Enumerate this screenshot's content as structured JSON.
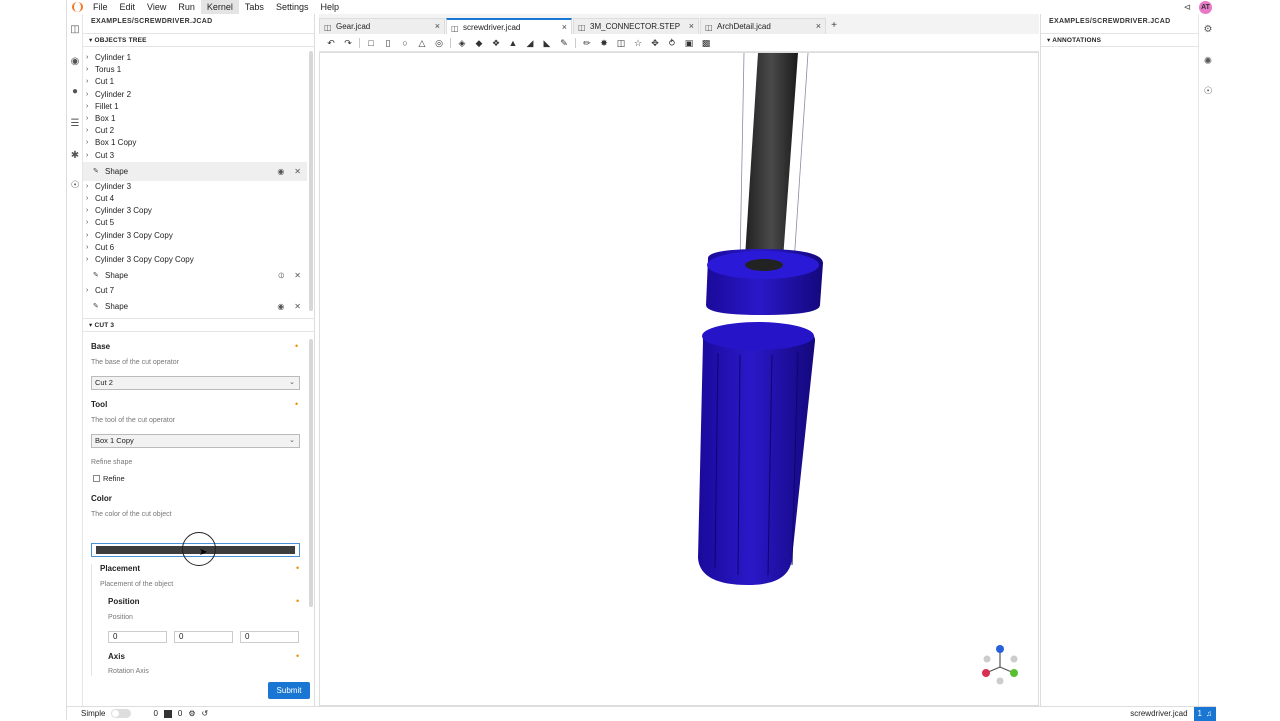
{
  "menu": [
    "File",
    "Edit",
    "View",
    "Run",
    "Kernel",
    "Tabs",
    "Settings",
    "Help"
  ],
  "menu_active": "Kernel",
  "user_initials": "AT",
  "left_panel": {
    "path": "EXAMPLES/SCREWDRIVER.JCAD",
    "objects_tree_title": "OBJECTS TREE",
    "tree": [
      {
        "label": "Cylinder 1",
        "type": "item"
      },
      {
        "label": "Torus 1",
        "type": "item"
      },
      {
        "label": "Cut 1",
        "type": "item"
      },
      {
        "label": "Cylinder 2",
        "type": "item"
      },
      {
        "label": "Fillet 1",
        "type": "item"
      },
      {
        "label": "Box 1",
        "type": "item"
      },
      {
        "label": "Cut 2",
        "type": "item"
      },
      {
        "label": "Box 1 Copy",
        "type": "item"
      },
      {
        "label": "Cut 3",
        "type": "item"
      },
      {
        "label": "Shape",
        "type": "shape",
        "visible": true,
        "highlighted": true
      },
      {
        "label": "Cylinder 3",
        "type": "item"
      },
      {
        "label": "Cut 4",
        "type": "item"
      },
      {
        "label": "Cylinder 3 Copy",
        "type": "item"
      },
      {
        "label": "Cut 5",
        "type": "item"
      },
      {
        "label": "Cylinder 3 Copy Copy",
        "type": "item"
      },
      {
        "label": "Cut 6",
        "type": "item"
      },
      {
        "label": "Cylinder 3 Copy Copy Copy",
        "type": "item"
      },
      {
        "label": "Shape",
        "type": "shape",
        "visible": false,
        "highlighted": false
      },
      {
        "label": "Cut 7",
        "type": "item"
      },
      {
        "label": "Shape",
        "type": "shape",
        "visible": true,
        "highlighted": false
      }
    ],
    "form_title": "CUT 3",
    "form": {
      "base_label": "Base",
      "base_desc": "The base of the cut operator",
      "base_value": "Cut 2",
      "tool_label": "Tool",
      "tool_desc": "The tool of the cut operator",
      "tool_value": "Box 1 Copy",
      "refine_desc": "Refine shape",
      "refine_label": "Refine",
      "color_label": "Color",
      "color_desc": "The color of the cut object",
      "color_value": "#3d3d3d",
      "placement_label": "Placement",
      "placement_desc": "Placement of the object",
      "position_label": "Position",
      "position_desc": "Position",
      "position_values": [
        "0",
        "0",
        "0"
      ],
      "axis_label": "Axis",
      "axis_desc": "Rotation Axis",
      "submit_label": "Submit"
    }
  },
  "tabs": [
    {
      "label": "Gear.jcad",
      "active": false
    },
    {
      "label": "screwdriver.jcad",
      "active": true
    },
    {
      "label": "3M_CONNECTOR.STEP",
      "active": false
    },
    {
      "label": "ArchDetail.jcad",
      "active": false
    }
  ],
  "toolbar_icons": [
    "undo-icon",
    "redo-icon",
    "sep",
    "box-icon",
    "cylinder-icon",
    "sphere-icon",
    "cone-icon",
    "torus-icon",
    "sep",
    "extrude-icon",
    "cut-icon",
    "union-icon",
    "intersection-icon",
    "chamfer-icon",
    "fillet-icon",
    "sketch-icon",
    "sep",
    "pencil-icon",
    "explode-icon",
    "clip-icon",
    "star-icon",
    "move-icon",
    "axes-icon",
    "camera-icon",
    "terminal-icon"
  ],
  "right_panel": {
    "path": "EXAMPLES/SCREWDRIVER.JCAD",
    "annotations_title": "ANNOTATIONS"
  },
  "status": {
    "mode_label": "Simple",
    "count_a": "0",
    "count_b": "0",
    "filename": "screwdriver.jcad",
    "notifications": "1"
  },
  "colors": {
    "accent": "#1976d2",
    "handle": "#1a0aa8",
    "shaft": "#2b2b2b",
    "required": "#f08c00"
  }
}
